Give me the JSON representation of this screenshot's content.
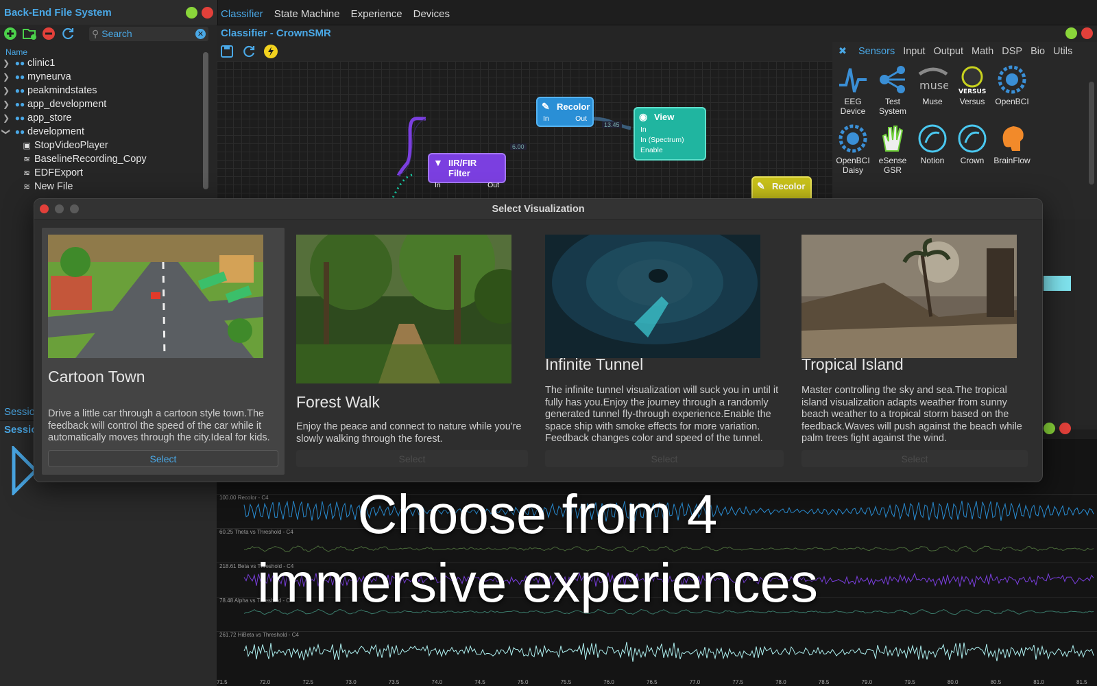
{
  "left_panel": {
    "title": "Back-End File System",
    "search_placeholder": "Search",
    "column_header": "Name",
    "tree": [
      {
        "label": "clinic1"
      },
      {
        "label": "myneurva"
      },
      {
        "label": "peakmindstates"
      },
      {
        "label": "app_development"
      },
      {
        "label": "app_store"
      },
      {
        "label": "development"
      },
      {
        "label": "StopVideoPlayer"
      },
      {
        "label": "BaselineRecording_Copy"
      },
      {
        "label": "EDFExport"
      },
      {
        "label": "New File"
      }
    ],
    "session_tab_a": "Sessio",
    "session_tab_b": "Sessio"
  },
  "main_tabs": [
    "Classifier",
    "State Machine",
    "Experience",
    "Devices"
  ],
  "classifier": {
    "title": "Classifier - CrownSMR",
    "nodes": {
      "recolor1": {
        "title": "Recolor",
        "in": "In",
        "out": "Out"
      },
      "view": {
        "title": "View",
        "ports": [
          "In",
          "In (Spectrum)",
          "Enable"
        ]
      },
      "filter": {
        "title": "IIR/FIR Filter",
        "in": "In",
        "out": "Out"
      },
      "recolor2": {
        "title": "Recolor"
      }
    },
    "badge_value": "13.45"
  },
  "palette": {
    "tabs": [
      "Sensors",
      "Input",
      "Output",
      "Math",
      "DSP",
      "Bio",
      "Utils"
    ],
    "items": [
      {
        "label": "EEG\nDevice",
        "icon": "eeg-icon"
      },
      {
        "label": "Test\nSystem",
        "icon": "test-system-icon"
      },
      {
        "label": "Muse",
        "icon": "muse-icon"
      },
      {
        "label": "Versus",
        "icon": "versus-icon"
      },
      {
        "label": "OpenBCI",
        "icon": "openbci-icon"
      },
      {
        "label": "OpenBCI\nDaisy",
        "icon": "openbci-daisy-icon"
      },
      {
        "label": "eSense\nGSR",
        "icon": "gsr-hand-icon"
      },
      {
        "label": "Notion",
        "icon": "notion-icon"
      },
      {
        "label": "Crown",
        "icon": "crown-icon"
      },
      {
        "label": "BrainFlow",
        "icon": "brainflow-icon"
      }
    ]
  },
  "dialog": {
    "title": "Select Visualization",
    "select_label": "Select",
    "cards": [
      {
        "title": "Cartoon Town",
        "description": "Drive a little car through a cartoon style town.The feedback will control the speed of the car while it automatically moves through the city.Ideal for kids.",
        "selected": true
      },
      {
        "title": "Forest Walk",
        "description": "Enjoy the peace and connect to nature while you're slowly walking through the forest.",
        "selected": false
      },
      {
        "title": "Infinite Tunnel",
        "description": "The infinite tunnel visualization will suck you in until it fully has you.Enjoy the journey through a randomly generated tunnel fly-through experience.Enable the space ship with smoke effects for more variation. Feedback changes color and speed of the tunnel.",
        "selected": false
      },
      {
        "title": "Tropical Island",
        "description": "Master controlling the sky and sea.The tropical island visualization adapts weather from sunny beach weather to a tropical storm based on the feedback.Waves will push against the beach while palm trees fight against the wind.",
        "selected": false
      }
    ]
  },
  "plots": {
    "labels": [
      "100.00 Recolor - C4",
      "60.25 Theta vs Threshold - C4",
      "218.61 Beta vs Threshold - C4",
      "78.48 Alpha vs Threshold - C4",
      "261.72 HiBeta vs Threshold - C4"
    ],
    "x_ticks": [
      "71.5",
      "72.0",
      "72.5",
      "73.0",
      "73.5",
      "74.0",
      "74.5",
      "75.0",
      "75.5",
      "76.0",
      "76.5",
      "77.0",
      "77.5",
      "78.0",
      "78.5",
      "79.0",
      "79.5",
      "80.0",
      "80.5",
      "81.0",
      "81.5"
    ]
  },
  "caption": {
    "line1": "Choose from 4",
    "line2": "immersive experiences"
  },
  "colors": {
    "accent": "#4aa8e6",
    "node_blue": "#2a8fd6",
    "node_purple": "#7b3fe0",
    "node_teal": "#20b5a0",
    "node_yellow": "#c9c21a"
  }
}
